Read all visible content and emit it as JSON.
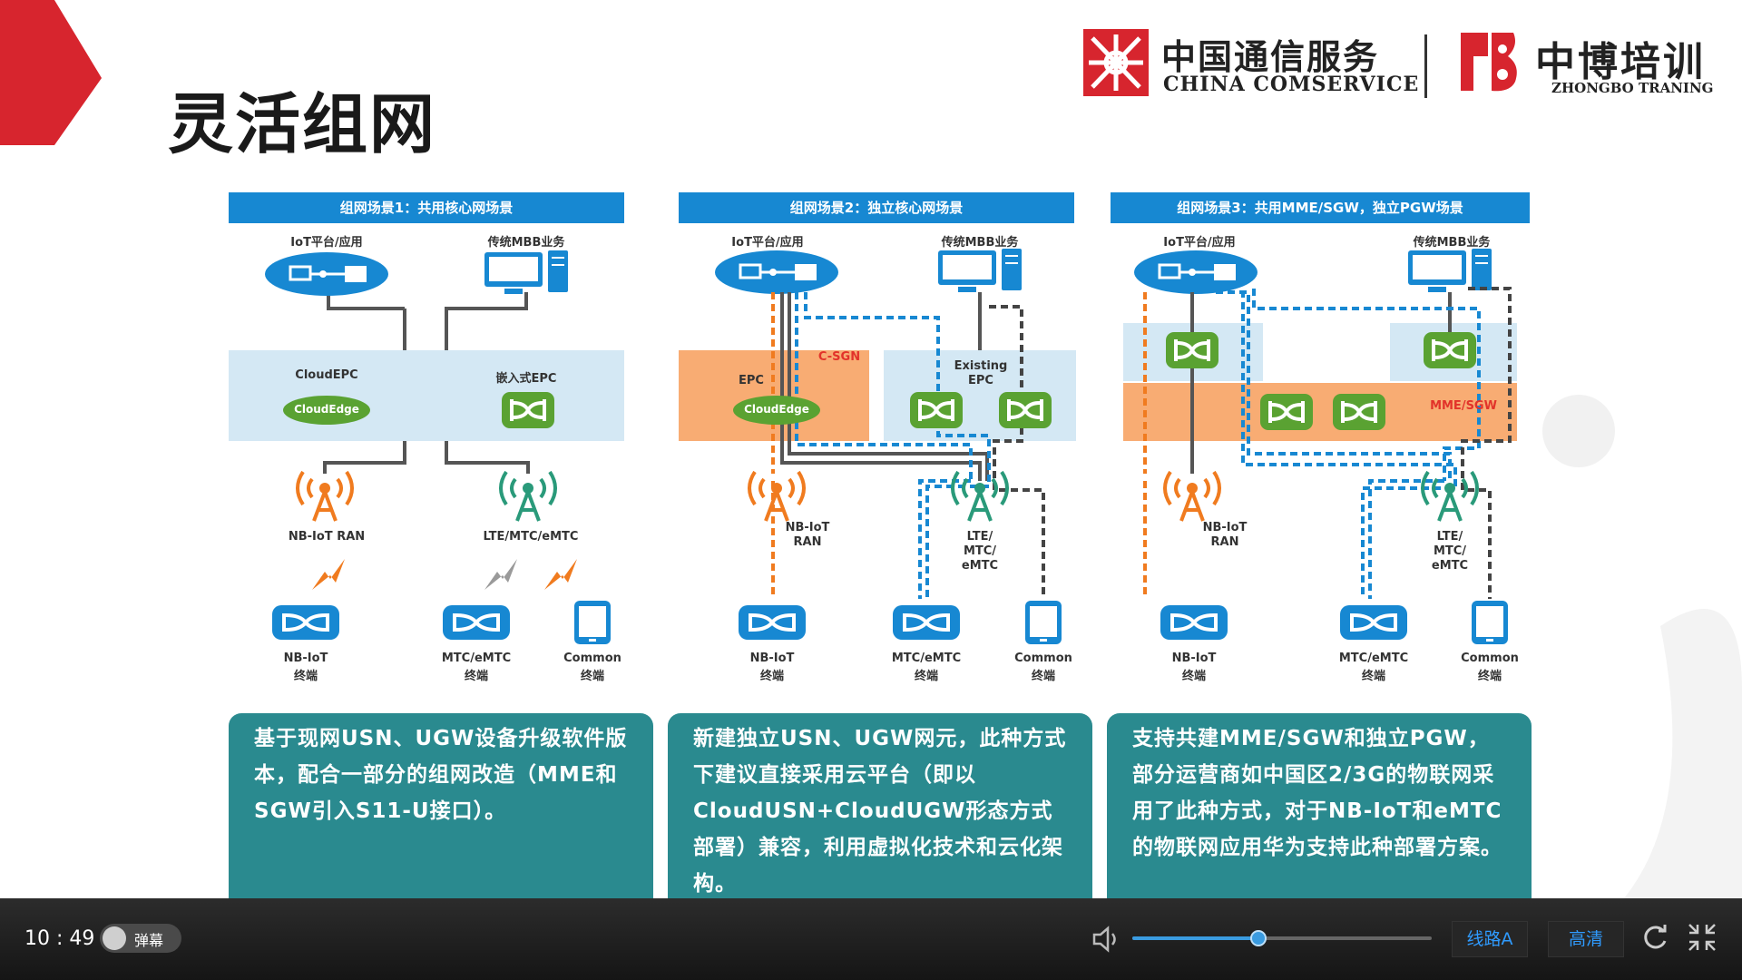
{
  "slide": {
    "title": "灵活组网"
  },
  "logos": {
    "china_comservice_cn": "中国通信服务",
    "china_comservice_en": "CHINA COMSERVICE",
    "zhongbo_cn": "中博培训",
    "zhongbo_en": "ZHONGBO TRANING"
  },
  "scenes": [
    {
      "header": "组网场景1：共用核心网场景",
      "top_left": "IoT平台/应用",
      "top_right": "传统MBB业务",
      "core_left": "CloudEPC",
      "core_right": "嵌入式EPC",
      "cloud_label": "CloudEdge",
      "ran_left": "NB-IoT RAN",
      "ran_right": "LTE/MTC/eMTC",
      "term1": "NB-IoT",
      "term1_sub": "终端",
      "term2": "MTC/eMTC",
      "term2_sub": "终端",
      "term3": "Common",
      "term3_sub": "终端",
      "description": "基于现网USN、UGW设备升级软件版本，配合一部分的组网改造（MME和SGW引入S11-U接口）。"
    },
    {
      "header": "组网场景2：独立核心网场景",
      "top_left": "IoT平台/应用",
      "top_right": "传统MBB业务",
      "epc_label": "EPC",
      "csgn_label": "C-SGN",
      "cloud_label": "CloudEdge",
      "existing_epc": "Existing EPC",
      "ran_left": "NB-IoT RAN",
      "ran_right": "LTE/ MTC/ eMTC",
      "term1": "NB-IoT",
      "term1_sub": "终端",
      "term2": "MTC/eMTC",
      "term2_sub": "终端",
      "term3": "Common",
      "term3_sub": "终端",
      "description": "新建独立USN、UGW网元，此种方式下建议直接采用云平台（即以CloudUSN+CloudUGW形态方式部署）兼容，利用虚拟化技术和云化架构。"
    },
    {
      "header": "组网场景3：共用MME/SGW，独立PGW场景",
      "top_left": "IoT平台/应用",
      "top_right": "传统MBB业务",
      "mme_label": "MME/SGW",
      "ran_left": "NB-IoT RAN",
      "ran_right": "LTE/ MTC/ eMTC",
      "term1": "NB-IoT",
      "term1_sub": "终端",
      "term2": "MTC/eMTC",
      "term2_sub": "终端",
      "term3": "Common",
      "term3_sub": "终端",
      "description": "支持共建MME/SGW和独立PGW，部分运营商如中国区2/3G的物联网采用了此种方式，对于NB-IoT和eMTC的物联网应用华为支持此种部署方案。"
    }
  ],
  "player": {
    "time": "10 : 49",
    "danmu_label": "弹幕",
    "line_button": "线路A",
    "quality_button": "高清",
    "volume_level": 0.42,
    "volume_icon": "speaker-icon",
    "refresh_icon": "refresh-icon",
    "collapse_icon": "exit-fullscreen-icon"
  },
  "colors": {
    "accent_red": "#d7252e",
    "header_blue": "#1788d2",
    "desc_teal": "#2a8a8f",
    "core_light_blue": "#d4e8f4",
    "core_orange": "#f8ac73",
    "node_green": "#5aa232",
    "device_blue": "#1788d2",
    "antenna_orange": "#f07b1f",
    "player_accent": "#2f9bff"
  }
}
